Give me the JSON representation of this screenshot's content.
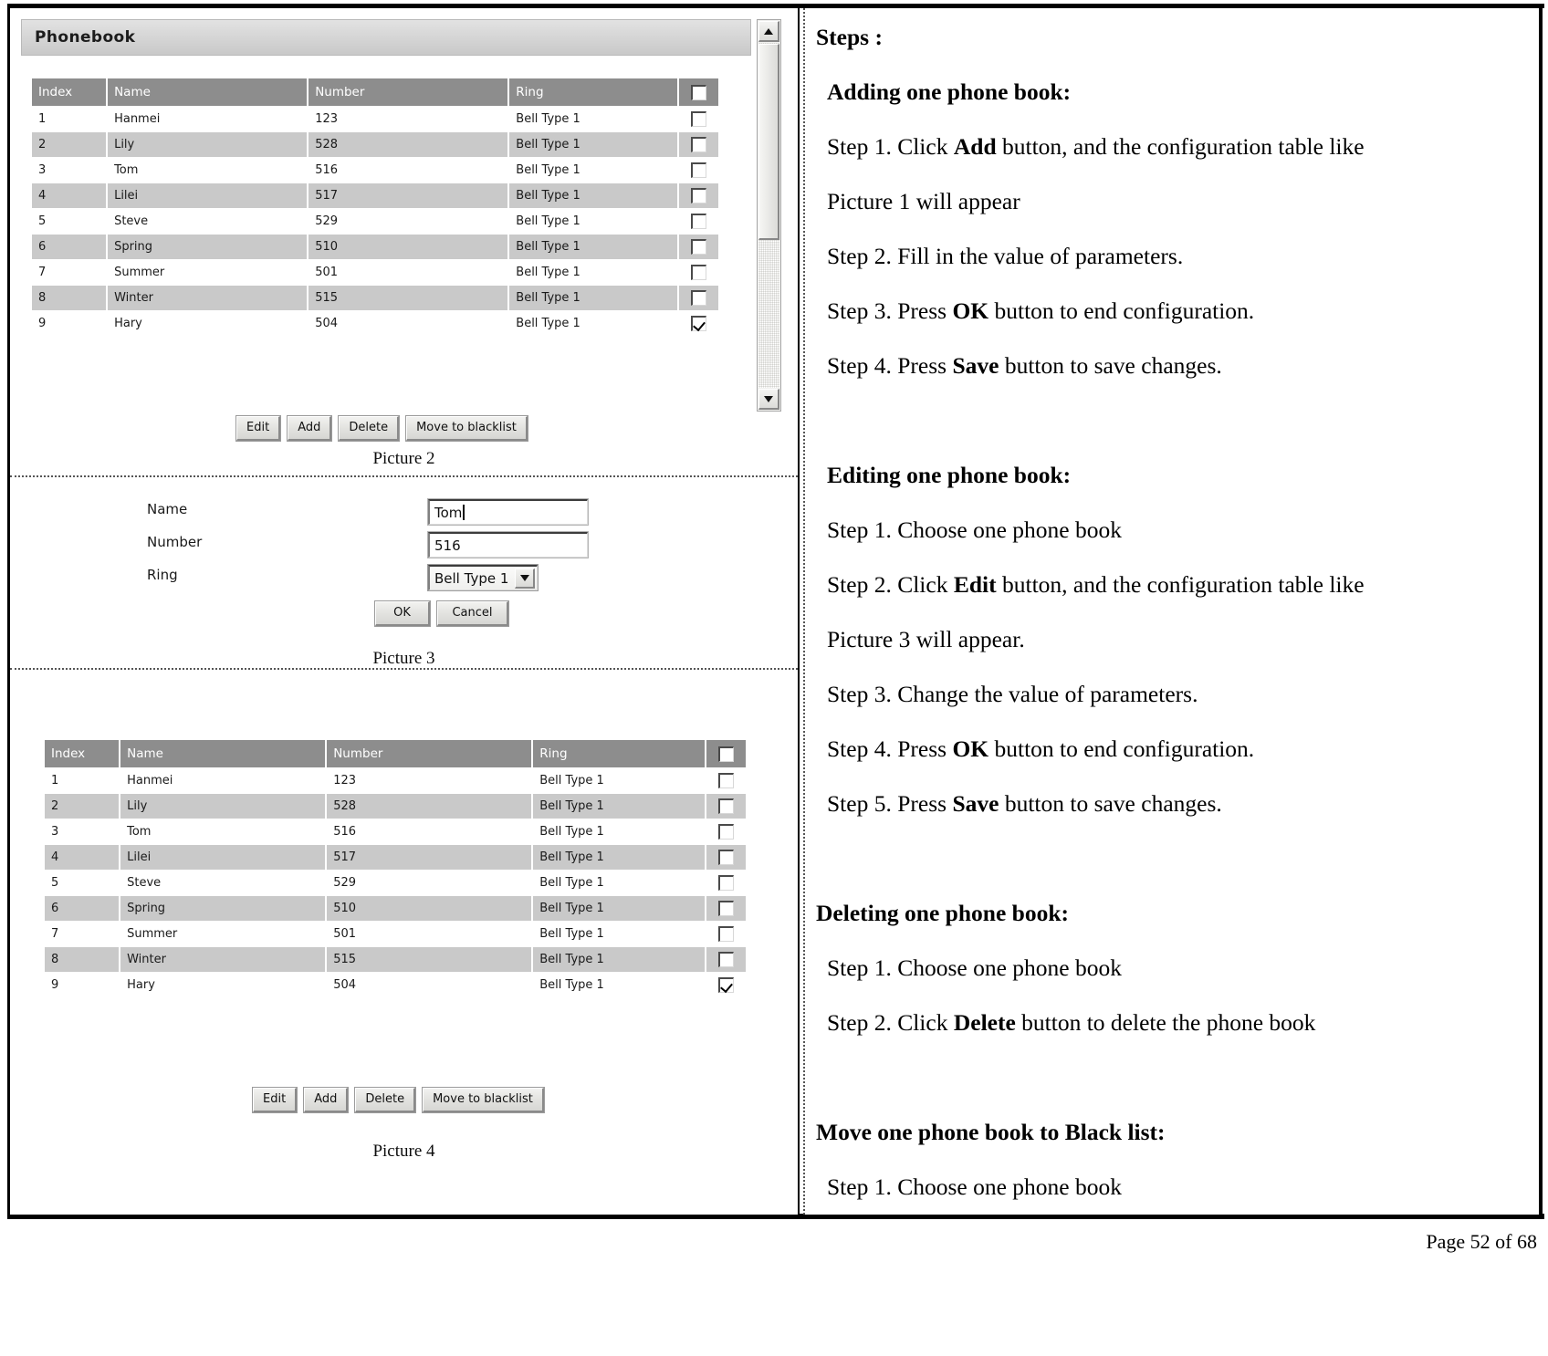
{
  "document": {
    "footer": "Page  52  of  68"
  },
  "phonebook": {
    "title": "Phonebook",
    "columns": [
      "Index",
      "Name",
      "Number",
      "Ring"
    ],
    "select_all_checked": false,
    "rows": [
      {
        "index": "1",
        "name": "Hanmei",
        "number": "123",
        "ring": "Bell Type 1",
        "checked": false
      },
      {
        "index": "2",
        "name": "Lily",
        "number": "528",
        "ring": "Bell Type 1",
        "checked": false
      },
      {
        "index": "3",
        "name": "Tom",
        "number": "516",
        "ring": "Bell Type 1",
        "checked": false
      },
      {
        "index": "4",
        "name": "Lilei",
        "number": "517",
        "ring": "Bell Type 1",
        "checked": false
      },
      {
        "index": "5",
        "name": "Steve",
        "number": "529",
        "ring": "Bell Type 1",
        "checked": false
      },
      {
        "index": "6",
        "name": "Spring",
        "number": "510",
        "ring": "Bell Type 1",
        "checked": false
      },
      {
        "index": "7",
        "name": "Summer",
        "number": "501",
        "ring": "Bell Type 1",
        "checked": false
      },
      {
        "index": "8",
        "name": "Winter",
        "number": "515",
        "ring": "Bell Type 1",
        "checked": false
      },
      {
        "index": "9",
        "name": "Hary",
        "number": "504",
        "ring": "Bell Type 1",
        "checked": true
      }
    ],
    "buttons": {
      "edit": "Edit",
      "add": "Add",
      "delete": "Delete",
      "move_to_blacklist": "Move to blacklist"
    }
  },
  "captions": {
    "picture2": "Picture 2",
    "picture3": "Picture 3",
    "picture4": "Picture 4"
  },
  "edit_form": {
    "labels": {
      "name": "Name",
      "number": "Number",
      "ring": "Ring"
    },
    "values": {
      "name": "Tom",
      "number": "516",
      "ring": "Bell Type 1"
    },
    "buttons": {
      "ok": "OK",
      "cancel": "Cancel"
    }
  },
  "steps_panel": {
    "heading": "Steps :",
    "sections": [
      {
        "title": "Adding one phone book:",
        "lines": [
          {
            "pre": "Step 1. Click ",
            "bold": "Add",
            "post": " button, and the configuration table like"
          },
          {
            "pre": "Picture 1 will appear",
            "bold": "",
            "post": ""
          },
          {
            "pre": "Step 2. Fill in the value of parameters.",
            "bold": "",
            "post": ""
          },
          {
            "pre": "Step 3. Press ",
            "bold": "OK",
            "post": " button to end configuration."
          },
          {
            "pre": "Step 4. Press ",
            "bold": "Save",
            "post": " button to save changes."
          }
        ]
      },
      {
        "title": "Editing one phone book:",
        "lines": [
          {
            "pre": "Step 1. Choose one phone book",
            "bold": "",
            "post": ""
          },
          {
            "pre": "Step 2. Click ",
            "bold": "Edit",
            "post": " button, and the configuration table like"
          },
          {
            "pre": "Picture 3 will appear.",
            "bold": "",
            "post": ""
          },
          {
            "pre": "Step 3. Change the value of parameters.",
            "bold": "",
            "post": ""
          },
          {
            "pre": "Step 4. Press ",
            "bold": "OK",
            "post": " button to end configuration."
          },
          {
            "pre": "Step 5. Press ",
            "bold": "Save",
            "post": " button to save changes."
          }
        ]
      },
      {
        "title": "Deleting one phone book:",
        "lines": [
          {
            "pre": "Step 1. Choose one phone book",
            "bold": "",
            "post": ""
          },
          {
            "pre": "Step 2. Click ",
            "bold": "Delete",
            "post": " button to delete the phone book"
          }
        ]
      },
      {
        "title": "Move one phone book to Black list:",
        "lines": [
          {
            "pre": "Step 1. Choose one phone book",
            "bold": "",
            "post": ""
          }
        ]
      }
    ]
  }
}
